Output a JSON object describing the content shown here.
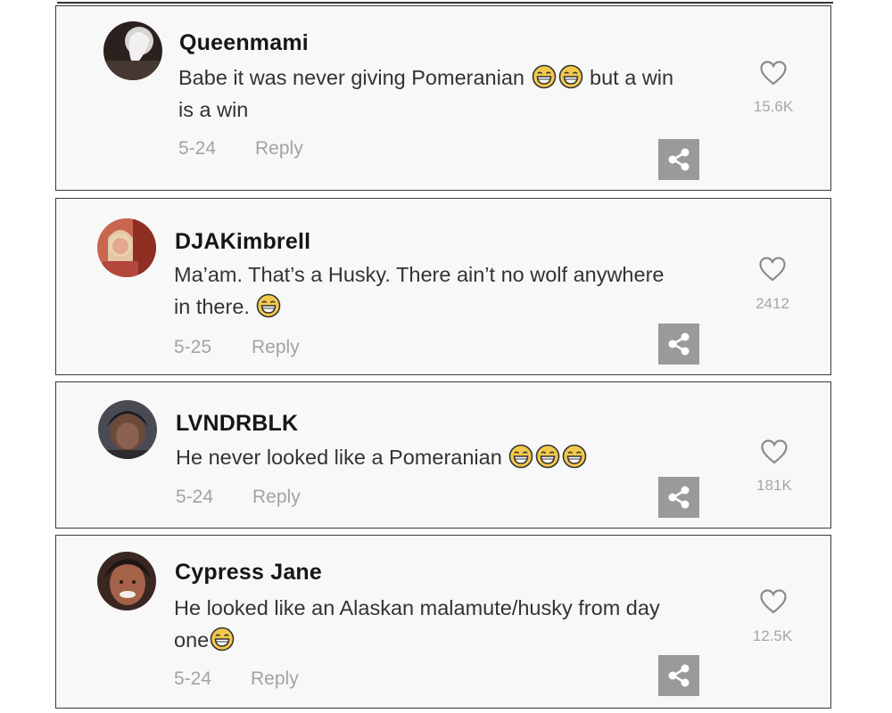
{
  "comments": [
    {
      "username": "Queenmami",
      "text_lines": [
        "Babe it was never giving Pomeranian",
        "but a win",
        "is a win"
      ],
      "date": "5-24",
      "reply_label": "Reply",
      "likes": "15.6K",
      "emoji": "face-with-tears-of-joy",
      "emoji_count": 2
    },
    {
      "username": "DJAKimbrell",
      "text_lines": [
        "Ma’am. That’s a Husky. There ain’t no wolf anywhere",
        "in there."
      ],
      "date": "5-25",
      "reply_label": "Reply",
      "likes": "2412",
      "emoji": "face-with-tears-of-joy",
      "emoji_count": 1
    },
    {
      "username": "LVNDRBLK",
      "text_lines": [
        "He never looked like a Pomeranian"
      ],
      "date": "5-24",
      "reply_label": "Reply",
      "likes": "181K",
      "emoji": "face-with-tears-of-joy",
      "emoji_count": 3
    },
    {
      "username": "Cypress Jane",
      "text_lines": [
        "He looked like an Alaskan malamute/husky from day",
        "one"
      ],
      "date": "5-24",
      "reply_label": "Reply",
      "likes": "12.5K",
      "emoji": "face-with-tears-of-joy",
      "emoji_count": 1
    }
  ],
  "icons": {
    "like": "heart-outline-icon",
    "share": "share-icon"
  },
  "colors": {
    "card_background": "#f8f8f8",
    "card_border": "#3a3a3a",
    "meta_text": "#a3a3a3",
    "share_button": "#9a9a9a",
    "emoji_face": "#f2c94c"
  }
}
